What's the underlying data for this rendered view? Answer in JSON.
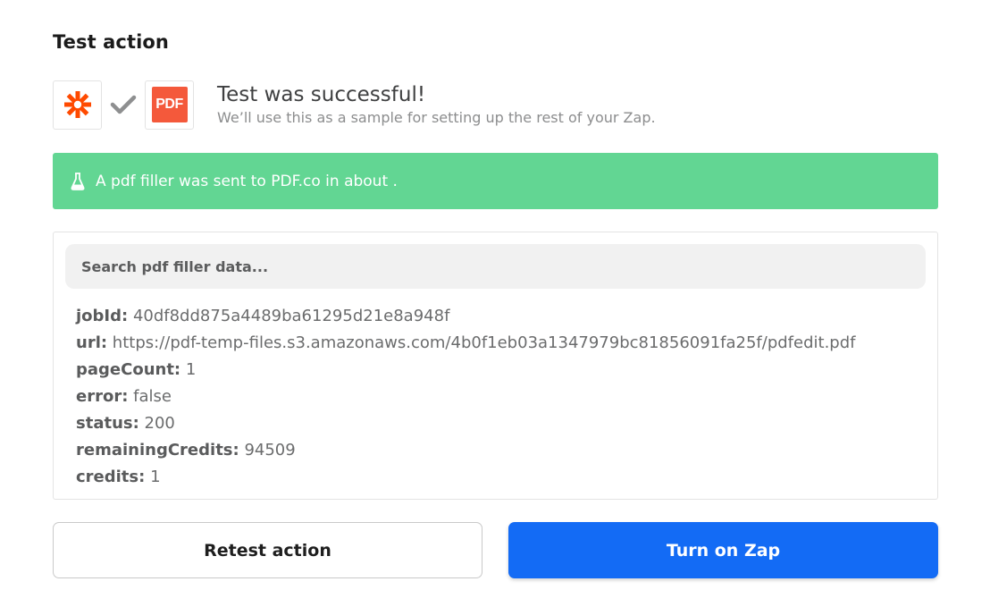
{
  "section_title": "Test action",
  "apps": {
    "trigger_icon": "zapier-asterisk-icon",
    "connector_icon": "checkmark-icon",
    "action_logo_text": "PDF"
  },
  "result": {
    "title": "Test was successful!",
    "subtitle": "We’ll use this as a sample for setting up the rest of your Zap."
  },
  "banner": {
    "icon": "flask-icon",
    "text": "A pdf filler was sent to PDF.co in about ."
  },
  "data_panel": {
    "search_placeholder": "Search pdf filler data...",
    "fields": [
      {
        "key": "jobId:",
        "value": "40df8dd875a4489ba61295d21e8a948f"
      },
      {
        "key": "url:",
        "value": "https://pdf-temp-files.s3.amazonaws.com/4b0f1eb03a1347979bc81856091fa25f/pdfedit.pdf"
      },
      {
        "key": "pageCount:",
        "value": "1"
      },
      {
        "key": "error:",
        "value": "false"
      },
      {
        "key": "status:",
        "value": "200"
      },
      {
        "key": "remainingCredits:",
        "value": "94509"
      },
      {
        "key": "credits:",
        "value": "1"
      }
    ]
  },
  "buttons": {
    "retest": "Retest action",
    "turn_on": "Turn on Zap"
  },
  "colors": {
    "banner_green": "#62d693",
    "primary_blue": "#136bf5",
    "zapier_orange": "#ff4a00",
    "pdf_orange": "#f4593b"
  }
}
